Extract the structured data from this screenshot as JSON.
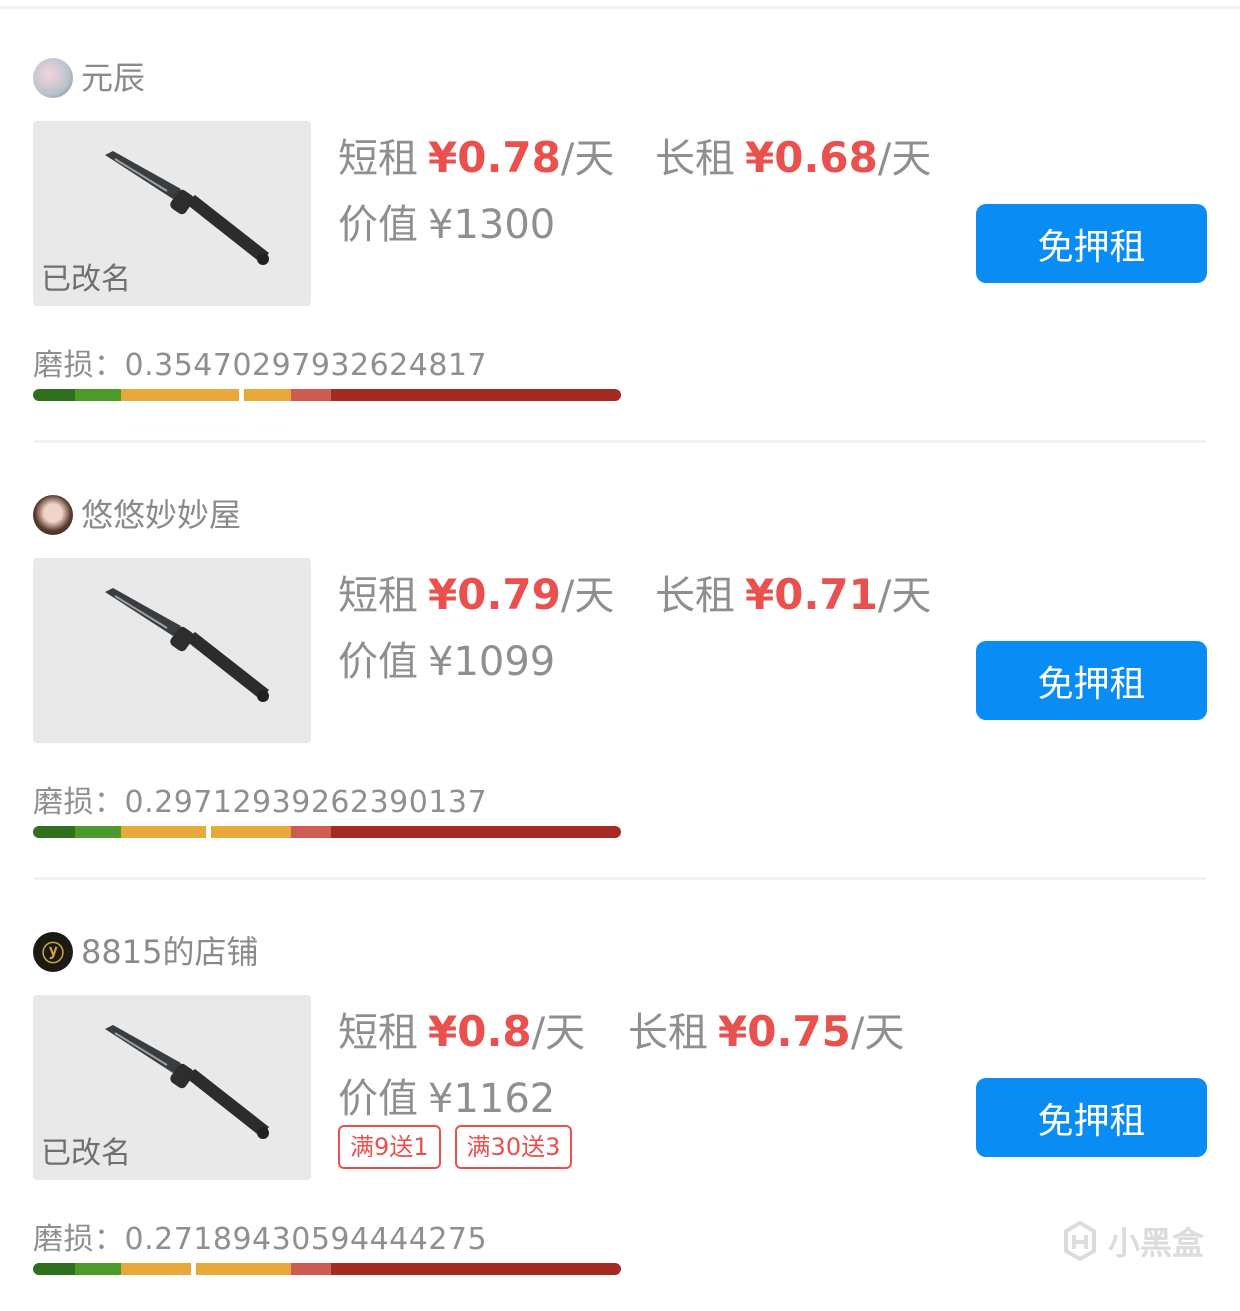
{
  "listings": [
    {
      "seller": "元辰",
      "avatar_icon": "avatar-flower",
      "renamed": "已改名",
      "short_label": "短租",
      "short_price": "¥0.78",
      "unit": "/天",
      "long_label": "长租",
      "long_price": "¥0.68",
      "long_unit": "/天",
      "value_label": "价值",
      "value": "¥1300",
      "button": "免押租",
      "wear_label": "磨损：",
      "wear": "0.35470297932624817",
      "wear_fraction": 0.3547
    },
    {
      "seller": "悠悠妙妙屋",
      "avatar_icon": "avatar-portrait",
      "renamed": "",
      "short_label": "短租",
      "short_price": "¥0.79",
      "unit": "/天",
      "long_label": "长租",
      "long_price": "¥0.71",
      "long_unit": "/天",
      "value_label": "价值",
      "value": "¥1099",
      "button": "免押租",
      "wear_label": "磨损：",
      "wear": "0.29712939262390137",
      "wear_fraction": 0.2971
    },
    {
      "seller": "8815的店铺",
      "avatar_icon": "avatar-logo",
      "renamed": "已改名",
      "short_label": "短租",
      "short_price": "¥0.8",
      "unit": "/天",
      "long_label": "长租",
      "long_price": "¥0.75",
      "long_unit": "/天",
      "value_label": "价值",
      "value": "¥1162",
      "promos": [
        "满9送1",
        "满30送3"
      ],
      "button": "免押租",
      "wear_label": "磨损：",
      "wear": "0.27189430594444275",
      "wear_fraction": 0.2719
    }
  ],
  "watermark": "小黑盒",
  "colors": {
    "price": "#e8514e",
    "button": "#0a8cf5"
  }
}
